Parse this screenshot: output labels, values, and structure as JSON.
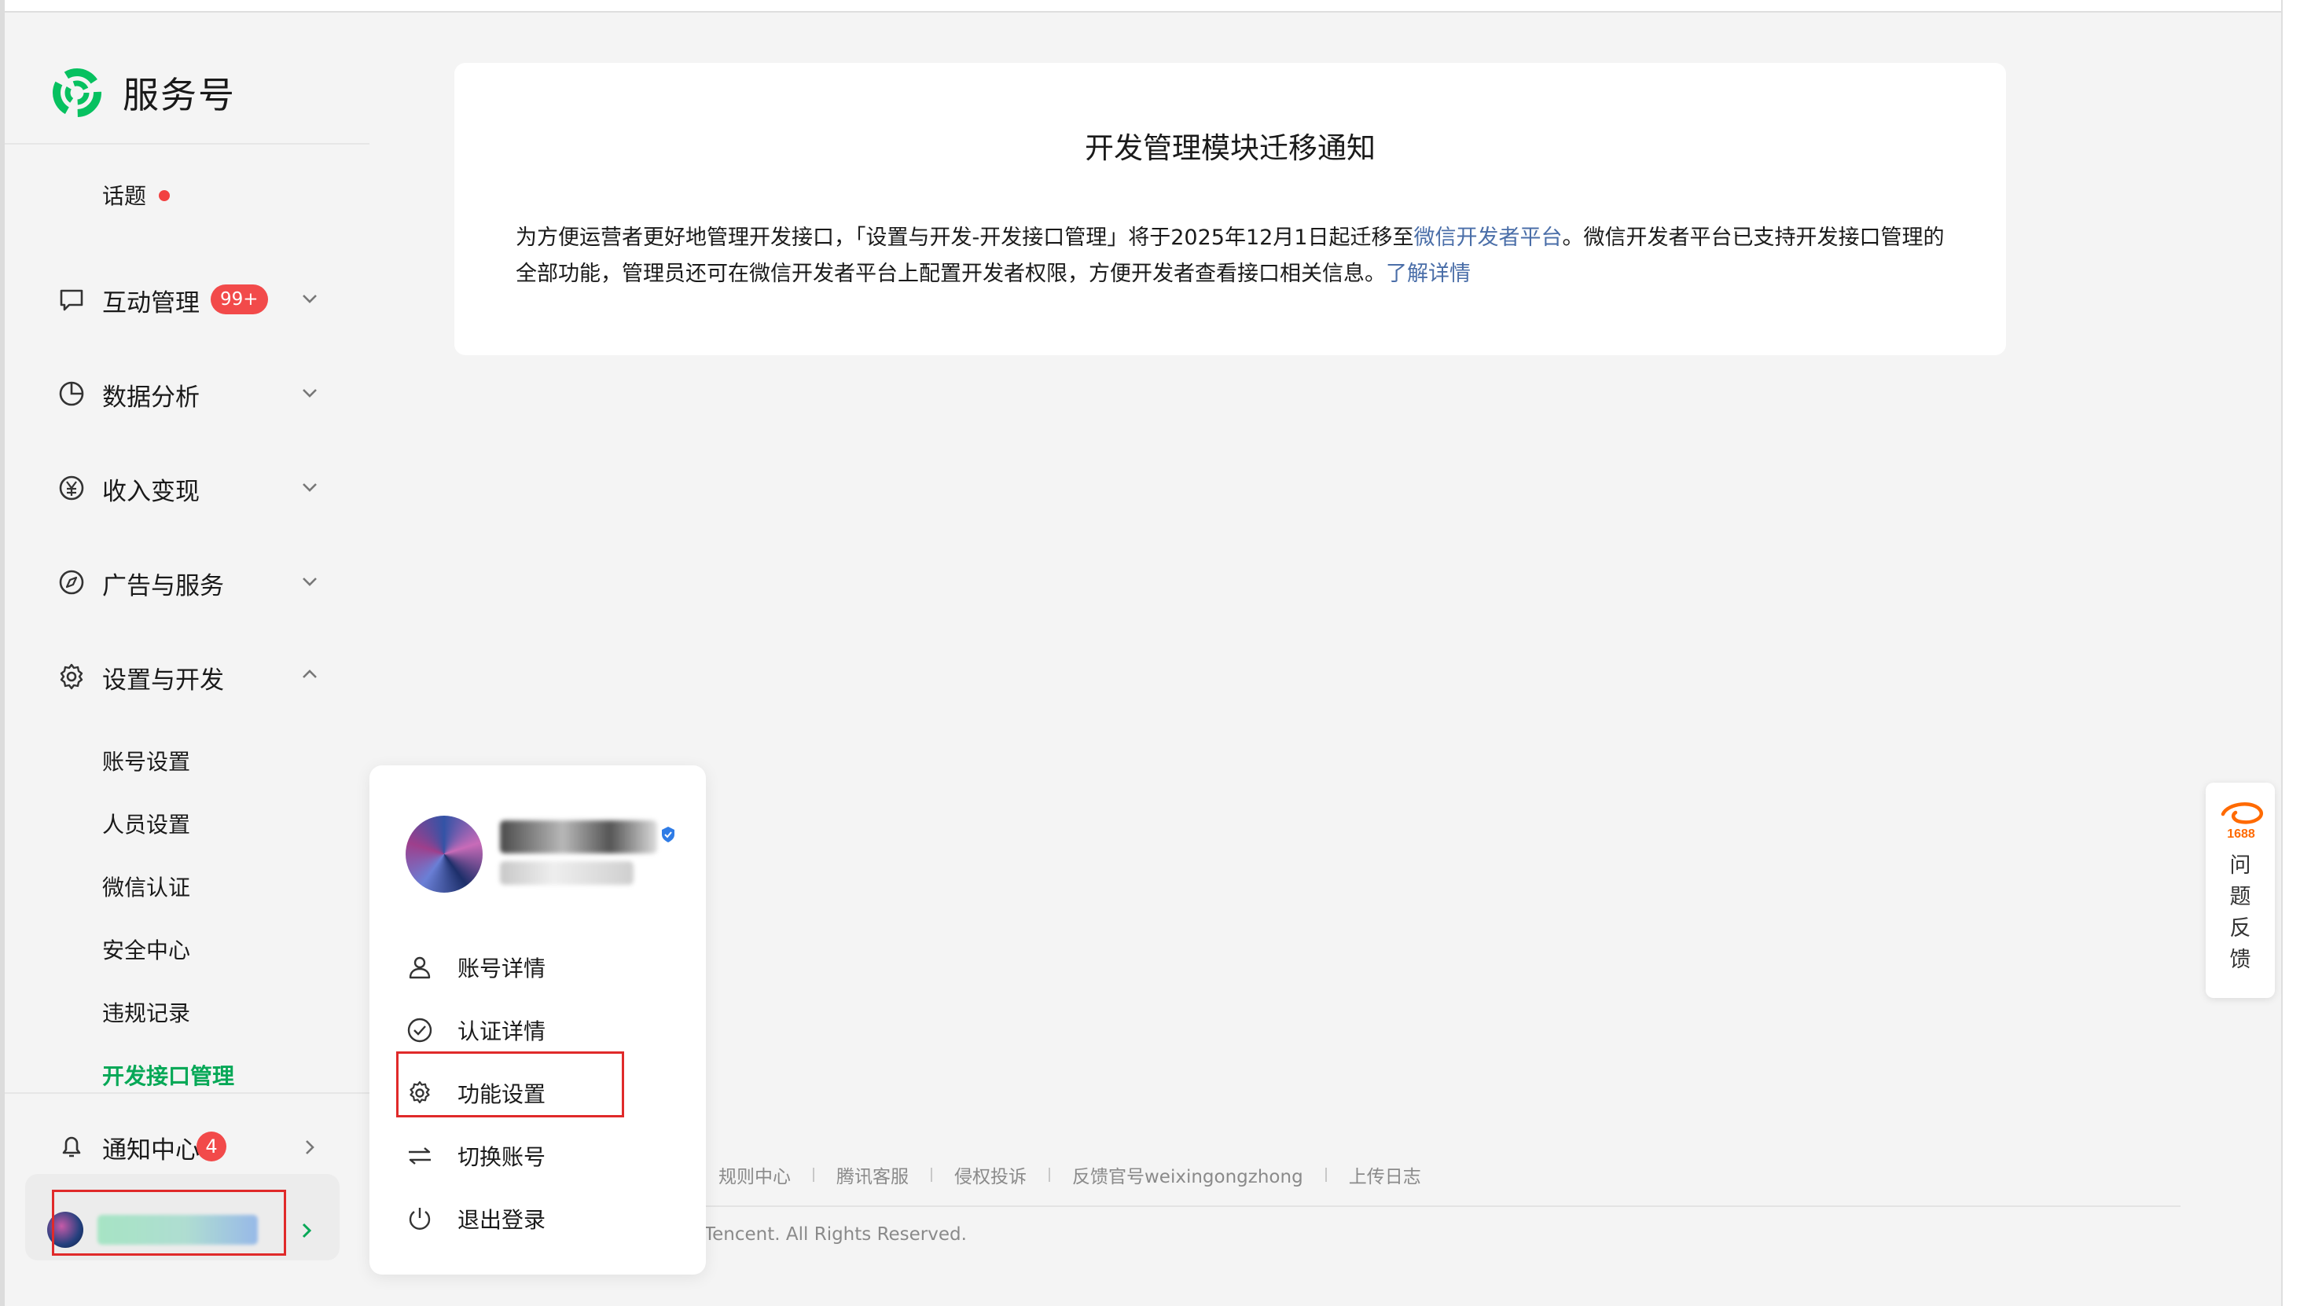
{
  "brand": {
    "name": "服务号"
  },
  "sidebar": {
    "topic": {
      "label": "话题"
    },
    "menu": [
      {
        "label": "互动管理",
        "badge": "99+"
      },
      {
        "label": "数据分析"
      },
      {
        "label": "收入变现"
      },
      {
        "label": "广告与服务"
      },
      {
        "label": "设置与开发"
      }
    ],
    "submenu": [
      "账号设置",
      "人员设置",
      "微信认证",
      "安全中心",
      "违规记录",
      "开发接口管理"
    ],
    "notifications": {
      "label": "通知中心",
      "count": "4"
    }
  },
  "notice": {
    "title": "开发管理模块迁移通知",
    "body_part1": "为方便运营者更好地管理开发接口，「设置与开发-开发接口管理」将于2025年12月1日起迁移至",
    "link1": "微信开发者平台",
    "body_part2": "。微信开发者平台已支持开发接口管理的全部功能，管理员还可在微信开发者平台上配置开发者权限，方便开发者查看接口相关信息。",
    "link2": "了解详情"
  },
  "popup": {
    "items": [
      {
        "label": "账号详情",
        "icon": "user-icon"
      },
      {
        "label": "认证详情",
        "icon": "check-circle-icon"
      },
      {
        "label": "功能设置",
        "icon": "gear-icon"
      },
      {
        "label": "切换账号",
        "icon": "switch-icon"
      },
      {
        "label": "退出登录",
        "icon": "power-icon"
      }
    ]
  },
  "footer": {
    "links": [
      "规则中心",
      "腾讯客服",
      "侵权投诉",
      "反馈官号weixingongzhong",
      "上传日志"
    ],
    "copyright": "Tencent. All Rights Reserved."
  },
  "feedback": {
    "logo_text": "1688",
    "label": "问题反馈"
  },
  "colors": {
    "accent_green": "#07a857",
    "link_blue": "#4a6ea8",
    "badge_red": "#f24a4a",
    "highlight_red": "#e02a2a"
  }
}
